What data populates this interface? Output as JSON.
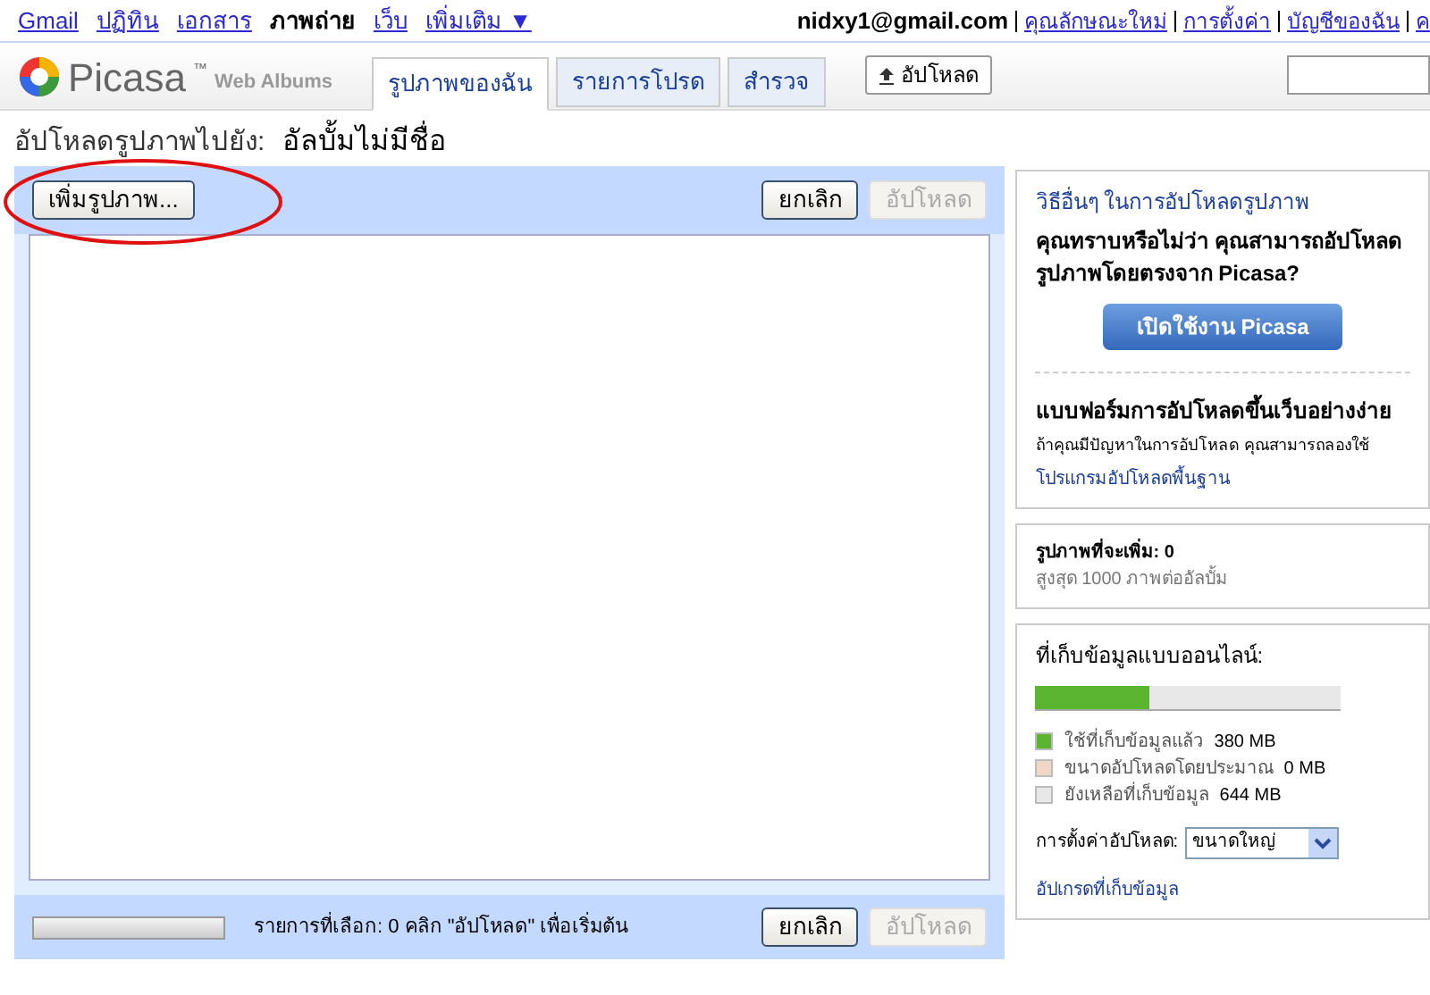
{
  "top_nav": {
    "links": [
      {
        "label": "Gmail",
        "selected": false
      },
      {
        "label": "ปฏิทิน",
        "selected": false
      },
      {
        "label": "เอกสาร",
        "selected": false
      },
      {
        "label": "ภาพถ่าย",
        "selected": true
      },
      {
        "label": "เว็บ",
        "selected": false
      },
      {
        "label": "เพิ่มเติม ▼",
        "selected": false
      }
    ],
    "account": "nidxy1@gmail.com",
    "account_links": [
      "คุณลักษณะใหม่",
      "การตั้งค่า",
      "บัญชีของฉัน",
      "ค"
    ]
  },
  "header": {
    "logo": "Picasa",
    "logo_tm": "™",
    "logo_sub": "Web Albums",
    "tabs": [
      {
        "label": "รูปภาพของฉัน",
        "selected": true
      },
      {
        "label": "รายการโปรด",
        "selected": false
      },
      {
        "label": "สำรวจ",
        "selected": false
      }
    ],
    "upload_button": "อัปโหลด"
  },
  "title": {
    "label": "อัปโหลดรูปภาพไปยัง:",
    "album": "อัลบั้มไม่มีชื่อ"
  },
  "uploader": {
    "add_button": "เพิ่มรูปภาพ...",
    "cancel_button": "ยกเลิก",
    "upload_button": {
      "label": "อัปโหลด",
      "disabled": true
    },
    "progress": {
      "level": 0
    },
    "status": "รายการที่เลือก: 0 คลิก \"อัปโหลด\" เพื่อเริ่มต้น",
    "bottom_cancel": "ยกเลิก",
    "bottom_upload": {
      "label": "อัปโหลด",
      "disabled": true
    }
  },
  "sidebar": {
    "other_ways": {
      "heading": "วิธีอื่นๆ ในการอัปโหลดรูปภาพ",
      "question": "คุณทราบหรือไม่ว่า คุณสามารถอัปโหลดรูปภาพโดยตรงจาก Picasa?",
      "button": "เปิดใช้งาน Picasa",
      "simple_heading": "แบบฟอร์มการอัปโหลดขึ้นเว็บอย่างง่าย",
      "simple_text": "ถ้าคุณมีปัญหาในการอัปโหลด คุณสามารถลองใช้",
      "simple_link": "โปรแกรมอัปโหลดพื้นฐาน"
    },
    "count": {
      "label": "รูปภาพที่จะเพิ่ม: 0",
      "limit": "สูงสุด 1000 ภาพต่ออัลบั้ม"
    },
    "storage": {
      "heading": "ที่เก็บข้อมูลแบบออนไลน์:",
      "level": 0.37,
      "legend": [
        {
          "label": "ใช้ที่เก็บข้อมูลแล้ว",
          "value": "380 MB",
          "color": "#5cb531"
        },
        {
          "label": "ขนาดอัปโหลดโดยประมาณ",
          "value": "0 MB",
          "color": "#f2d7c9"
        },
        {
          "label": "ยังเหลือที่เก็บข้อมูล",
          "value": "644 MB",
          "color": "#e8e8e8"
        }
      ],
      "setting_label": "การตั้งค่าอัปโหลด:",
      "setting_value": "ขนาดใหญ่",
      "upgrade_link": "อัปเกรดที่เก็บข้อมูล"
    }
  }
}
